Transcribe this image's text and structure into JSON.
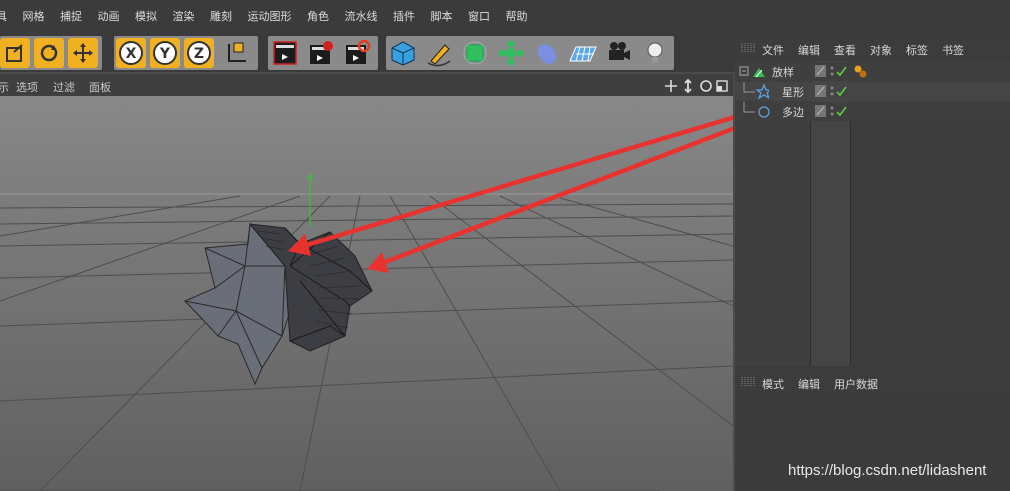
{
  "menubar": {
    "items": [
      "具",
      "网格",
      "捕捉",
      "动画",
      "模拟",
      "渲染",
      "雕刻",
      "运动图形",
      "角色",
      "流水线",
      "插件",
      "脚本",
      "窗口",
      "帮助"
    ]
  },
  "toolbar": {
    "axis_x": "X",
    "axis_y": "Y",
    "axis_z": "Z"
  },
  "viewport_header": {
    "items": [
      "示",
      "选项",
      "过滤",
      "面板"
    ]
  },
  "object_manager": {
    "menu": [
      "文件",
      "编辑",
      "查看",
      "对象",
      "标签",
      "书签"
    ],
    "objects": [
      {
        "name": "放样",
        "icon": "loft-icon",
        "level": 0
      },
      {
        "name": "星形",
        "icon": "star-spline-icon",
        "level": 1
      },
      {
        "name": "多边",
        "icon": "polygon-spline-icon",
        "level": 1
      }
    ]
  },
  "attribute_manager": {
    "menu": [
      "模式",
      "编辑",
      "用户数据"
    ]
  },
  "watermark": "https://blog.csdn.net/lidashent",
  "colors": {
    "accent_orange": "#e8a020",
    "arrow_red": "#e8322e",
    "check_green": "#5ccb3a"
  }
}
